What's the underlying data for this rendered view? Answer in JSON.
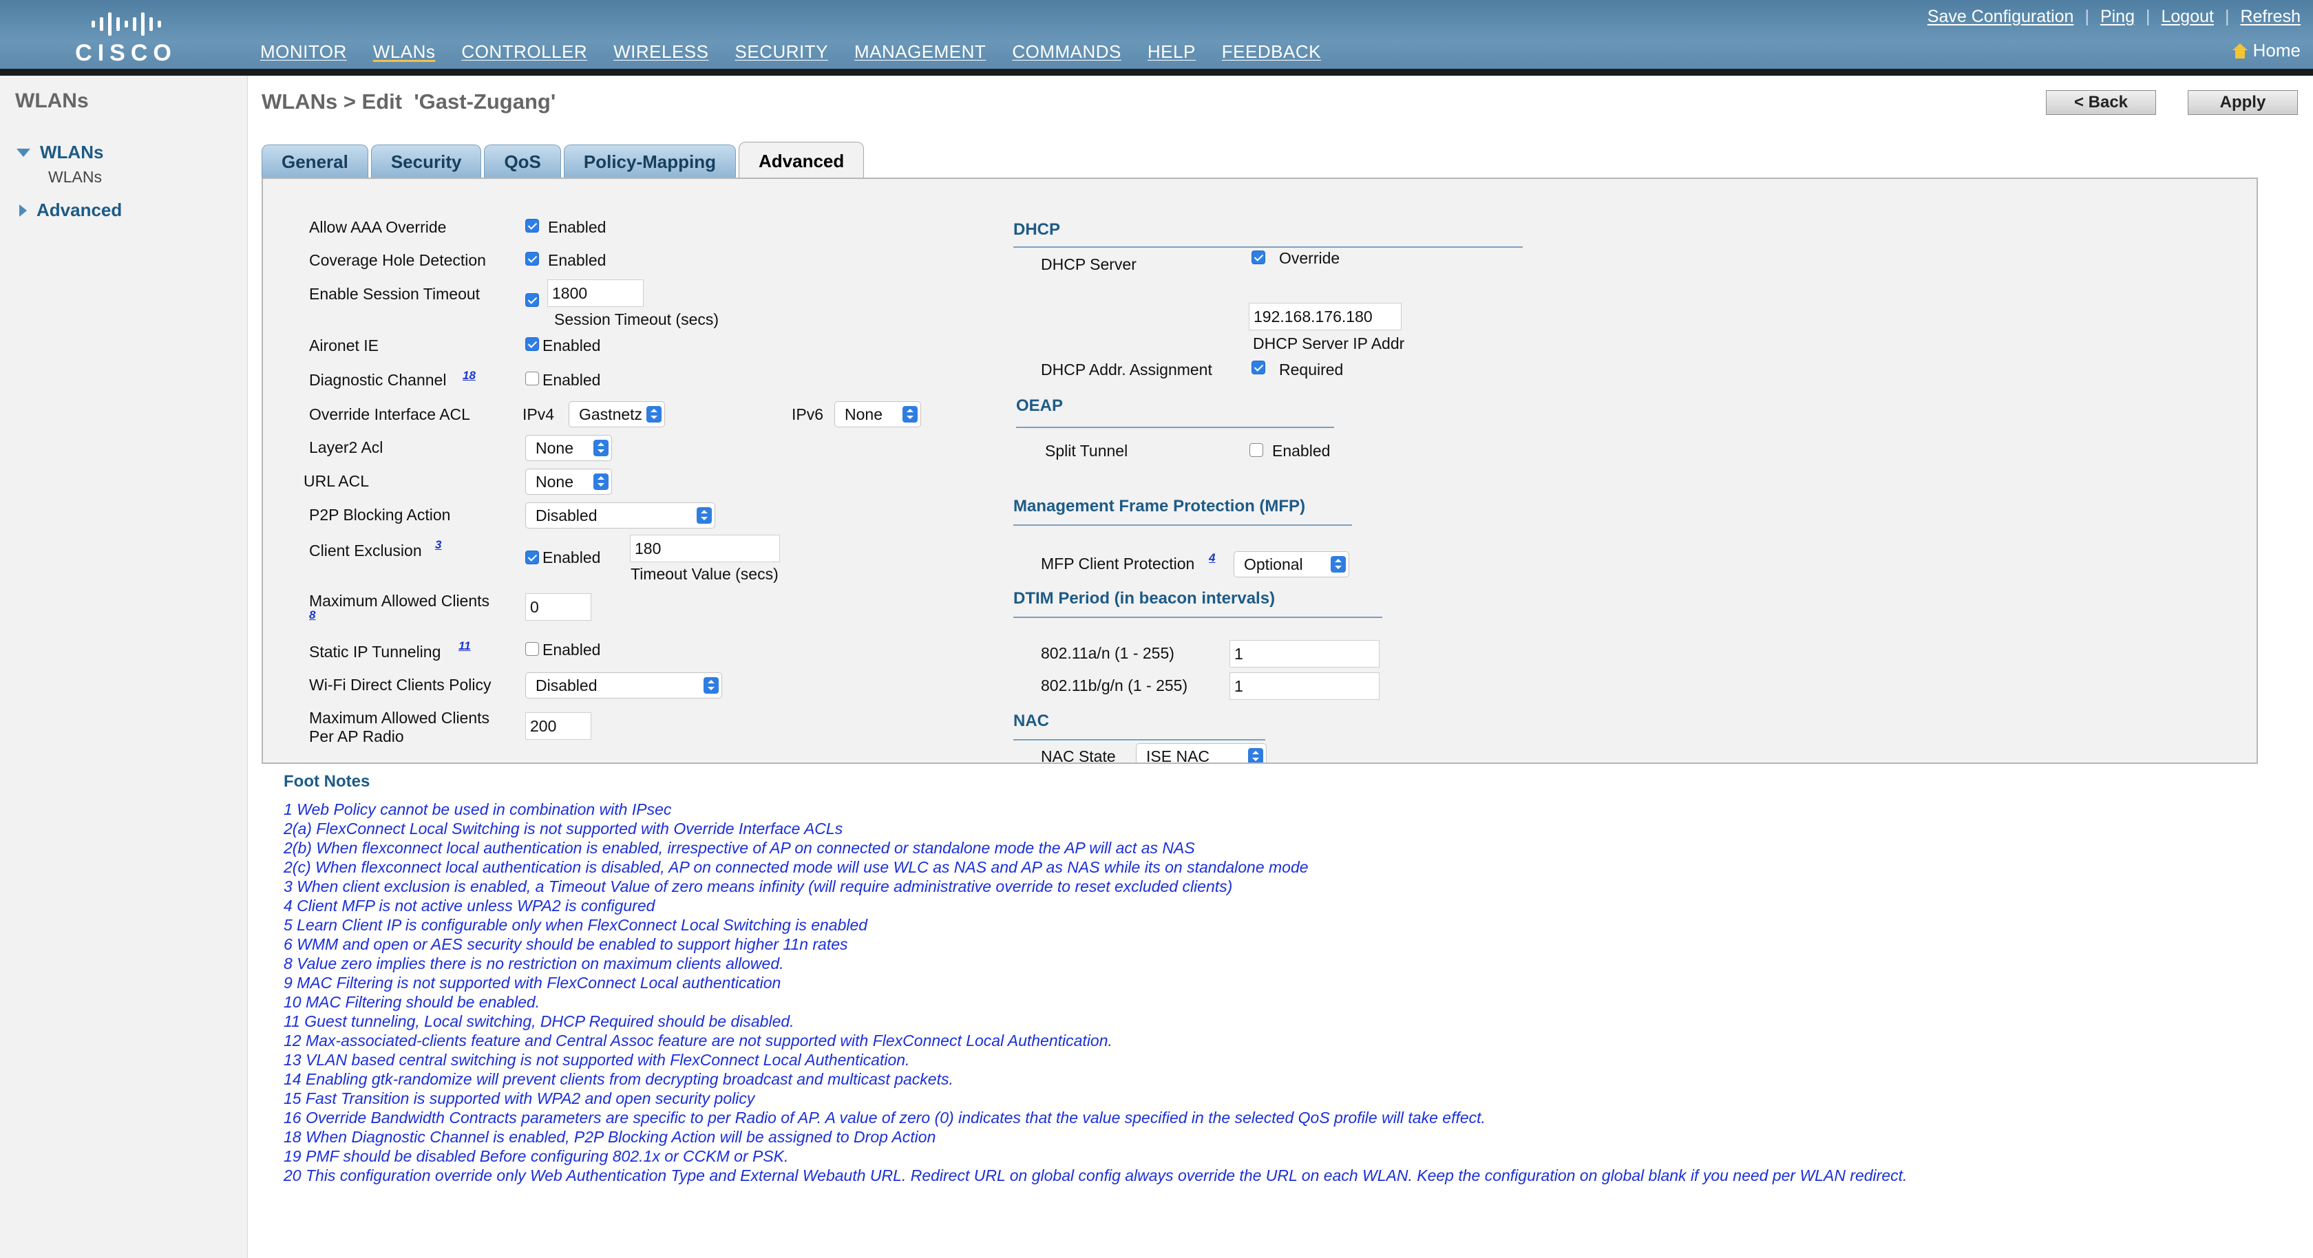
{
  "header": {
    "logo_text": "CISCO",
    "nav": [
      {
        "label": "MONITOR"
      },
      {
        "label": "WLANs"
      },
      {
        "label": "CONTROLLER"
      },
      {
        "label": "WIRELESS"
      },
      {
        "label": "SECURITY"
      },
      {
        "label": "MANAGEMENT"
      },
      {
        "label": "COMMANDS"
      },
      {
        "label": "HELP"
      },
      {
        "label": "FEEDBACK"
      }
    ],
    "links": {
      "save": "Save Configuration",
      "ping": "Ping",
      "logout": "Logout",
      "refresh": "Refresh",
      "home": "Home"
    },
    "icons": {
      "home": "home-icon",
      "logo": "cisco-logo"
    }
  },
  "sidebar": {
    "title": "WLANs",
    "items": [
      {
        "label": "WLANs",
        "expanded": true,
        "sub": "WLANs"
      },
      {
        "label": "Advanced",
        "expanded": false
      }
    ]
  },
  "page": {
    "title": "WLANs > Edit  'Gast-Zugang'",
    "back_label": "< Back",
    "apply_label": "Apply"
  },
  "tabs": [
    "General",
    "Security",
    "QoS",
    "Policy-Mapping",
    "Advanced"
  ],
  "active_tab": "Advanced",
  "left": {
    "allow_aaa": {
      "label": "Allow AAA Override",
      "checked": true,
      "text": "Enabled"
    },
    "coverage_hole": {
      "label": "Coverage Hole Detection",
      "checked": true,
      "text": "Enabled"
    },
    "session_timeout": {
      "label": "Enable Session Timeout",
      "checked": true,
      "value": "1800",
      "caption": "Session Timeout (secs)"
    },
    "aironet_ie": {
      "label": "Aironet IE",
      "checked": true,
      "text": "Enabled"
    },
    "diag_channel": {
      "label": "Diagnostic Channel",
      "footnote": "18",
      "checked": false,
      "text": "Enabled"
    },
    "override_acl": {
      "label": "Override Interface ACL",
      "ipv4_label": "IPv4",
      "ipv4_value": "Gastnetz",
      "ipv6_label": "IPv6",
      "ipv6_value": "None"
    },
    "layer2_acl": {
      "label": "Layer2 Acl",
      "value": "None"
    },
    "url_acl": {
      "label": "URL ACL",
      "value": "None"
    },
    "p2p": {
      "label": "P2P Blocking Action",
      "value": "Disabled"
    },
    "client_exclusion": {
      "label": "Client Exclusion",
      "footnote": "3",
      "checked": true,
      "text": "Enabled",
      "value": "180",
      "caption": "Timeout Value (secs)"
    },
    "max_clients": {
      "label": "Maximum Allowed Clients",
      "footnote": "8",
      "value": "0"
    },
    "static_ip": {
      "label": "Static IP Tunneling",
      "footnote": "11",
      "checked": false,
      "text": "Enabled"
    },
    "wifi_direct": {
      "label": "Wi-Fi Direct Clients Policy",
      "value": "Disabled"
    },
    "max_per_radio": {
      "label_line1": "Maximum Allowed Clients",
      "label_line2": "Per AP Radio",
      "value": "200"
    }
  },
  "right": {
    "dhcp": {
      "title": "DHCP",
      "server_label": "DHCP Server",
      "override_checked": true,
      "override_text": "Override",
      "ip_value": "192.168.176.180",
      "ip_caption": "DHCP Server IP Addr",
      "assign_label": "DHCP Addr. Assignment",
      "required_checked": true,
      "required_text": "Required"
    },
    "oeap": {
      "title": "OEAP",
      "split_label": "Split Tunnel",
      "checked": false,
      "text": "Enabled"
    },
    "mfp": {
      "title": "Management Frame Protection (MFP)",
      "label": "MFP Client Protection",
      "footnote": "4",
      "value": "Optional"
    },
    "dtim": {
      "title": "DTIM Period (in beacon intervals)",
      "a_label": "802.11a/n (1 - 255)",
      "a_value": "1",
      "b_label": "802.11b/g/n (1 - 255)",
      "b_value": "1"
    },
    "nac": {
      "title": "NAC",
      "state_label": "NAC State",
      "state_value": "ISE NAC"
    }
  },
  "footnotes": {
    "title": "Foot Notes",
    "lines": [
      "1 Web Policy cannot be used in combination with IPsec",
      "2(a) FlexConnect Local Switching is not supported with Override Interface ACLs",
      "2(b) When flexconnect local authentication is enabled, irrespective of AP on connected or standalone mode the AP will act as NAS",
      "2(c) When flexconnect local authentication is disabled, AP on connected mode will use WLC as NAS and AP as NAS while its on standalone mode",
      "3 When client exclusion is enabled, a Timeout Value of zero means infinity (will require administrative override to reset excluded clients)",
      "4 Client MFP is not active unless WPA2 is configured",
      "5 Learn Client IP is configurable only when FlexConnect Local Switching is enabled",
      "6 WMM and open or AES security should be enabled to support higher 11n rates",
      "8 Value zero implies there is no restriction on maximum clients allowed.",
      "9 MAC Filtering is not supported with FlexConnect Local authentication",
      "10 MAC Filtering should be enabled.",
      "11 Guest tunneling, Local switching, DHCP Required should be disabled.",
      "12 Max-associated-clients feature and Central Assoc feature are not supported with FlexConnect Local Authentication.",
      "13 VLAN based central switching is not supported with FlexConnect Local Authentication.",
      "14 Enabling gtk-randomize will prevent clients from decrypting broadcast and multicast packets.",
      "15 Fast Transition is supported with WPA2 and open security policy",
      "16 Override Bandwidth Contracts parameters are specific to per Radio of AP. A value of zero (0) indicates that the value specified in the selected QoS profile will take effect.",
      "18 When Diagnostic Channel is enabled, P2P Blocking Action will be assigned to Drop Action",
      "19 PMF should be disabled Before configuring 802.1x or CCKM or PSK.",
      "20 This configuration override only Web Authentication Type and External Webauth URL. Redirect URL on global config always override the URL on each WLAN. Keep the configuration on global blank if you need per WLAN redirect."
    ]
  },
  "colors": {
    "header": "#5d8aad",
    "section": "#1d5b86",
    "footnote": "#1a2fd8",
    "checkbox": "#2d7fe6"
  }
}
